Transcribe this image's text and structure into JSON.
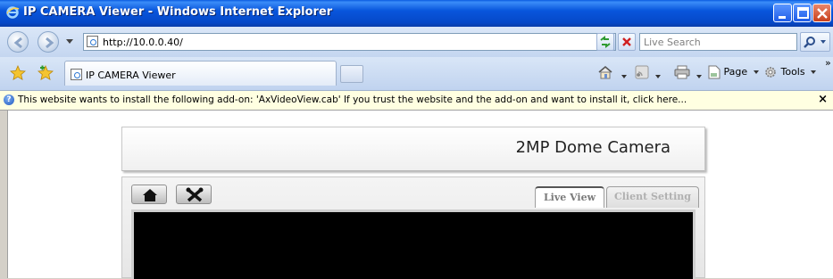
{
  "window": {
    "title": "IP CAMERA Viewer - Windows Internet Explorer"
  },
  "address_bar": {
    "url": "http://10.0.0.40/",
    "search_placeholder": "Live Search"
  },
  "tabs": [
    {
      "label": "IP CAMERA Viewer"
    }
  ],
  "command_bar": {
    "page_label": "Page",
    "tools_label": "Tools"
  },
  "info_bar": {
    "message": "This website wants to install the following add-on: 'AxVideoView.cab' If you trust the website and the add-on and want to install it, click here...",
    "close_glyph": "×"
  },
  "camera": {
    "title": "2MP Dome Camera",
    "tabs": [
      {
        "label": "Live View",
        "active": true
      },
      {
        "label": "Client Setting",
        "active": false
      }
    ]
  },
  "colors": {
    "titlebar": "#0856dc",
    "infobar": "#ffffe1",
    "video_bg": "#000000"
  }
}
